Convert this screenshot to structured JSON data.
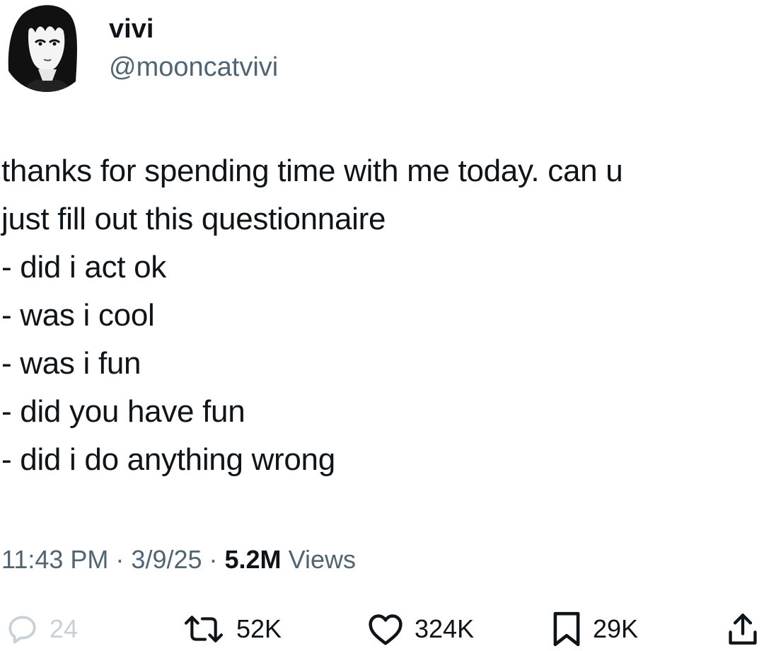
{
  "author": {
    "display_name": "vivi",
    "handle": "@mooncatvivi",
    "avatar_icon": "avatar-portrait"
  },
  "tweet": {
    "lines": [
      "thanks for spending time with me today. can u",
      "just fill out this questionnaire",
      "- did i act ok",
      "- was i cool",
      "- was i fun",
      "- did you have fun",
      "- did i do anything wrong"
    ]
  },
  "meta": {
    "time": "11:43 PM",
    "separator": " · ",
    "date": "3/9/25",
    "views_count": "5.2M",
    "views_label": "Views"
  },
  "actions": {
    "reply": {
      "icon": "reply-icon",
      "count": "24"
    },
    "retweet": {
      "icon": "retweet-icon",
      "count": "52K"
    },
    "like": {
      "icon": "heart-icon",
      "count": "324K"
    },
    "bookmark": {
      "icon": "bookmark-icon",
      "count": "29K"
    },
    "share": {
      "icon": "share-icon"
    }
  },
  "colors": {
    "text": "#0f1419",
    "secondary": "#536471",
    "muted": "#c9d1d6",
    "background": "#ffffff"
  }
}
